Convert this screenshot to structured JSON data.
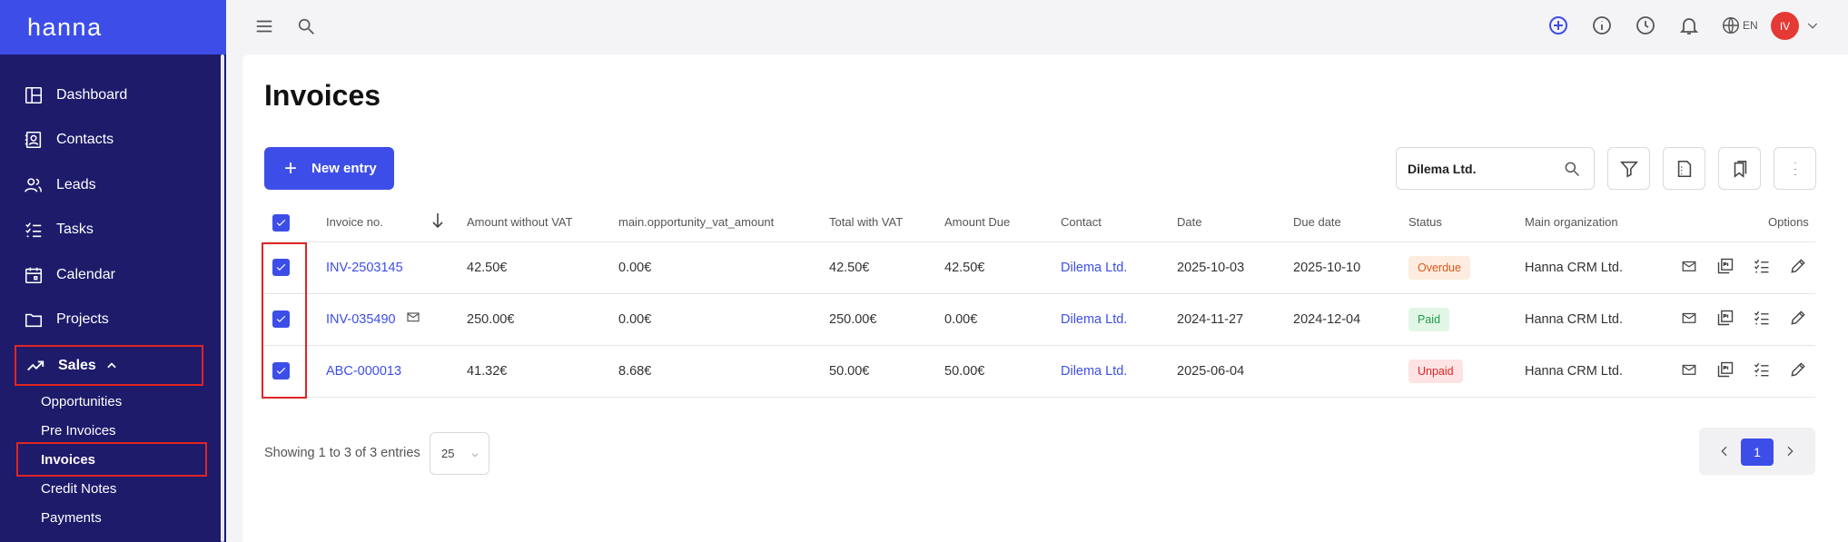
{
  "brand": "hanna",
  "sidebar": {
    "items": [
      {
        "label": "Dashboard",
        "icon": "dashboard-icon"
      },
      {
        "label": "Contacts",
        "icon": "contacts-icon"
      },
      {
        "label": "Leads",
        "icon": "leads-icon"
      },
      {
        "label": "Tasks",
        "icon": "tasks-icon"
      },
      {
        "label": "Calendar",
        "icon": "calendar-icon"
      },
      {
        "label": "Projects",
        "icon": "folder-icon"
      }
    ],
    "sales": {
      "label": "Sales",
      "icon": "trending-up-icon"
    },
    "sales_sub": [
      "Opportunities",
      "Pre Invoices",
      "Invoices",
      "Credit Notes",
      "Payments"
    ]
  },
  "topbar": {
    "lang": "EN",
    "avatar": "IV"
  },
  "page": {
    "title": "Invoices",
    "new_entry": "New entry",
    "search_value": "Dilema Ltd."
  },
  "table": {
    "headers": [
      "Invoice no.",
      "Amount without VAT",
      "main.opportunity_vat_amount",
      "Total with VAT",
      "Amount Due",
      "Contact",
      "Date",
      "Due date",
      "Status",
      "Main organization",
      "Options"
    ],
    "rows": [
      {
        "invoice": "INV-2503145",
        "amount": "42.50€",
        "vat": "0.00€",
        "total": "42.50€",
        "due_amount": "42.50€",
        "contact": "Dilema Ltd.",
        "date": "2025-10-03",
        "due_date": "2025-10-10",
        "status": "Overdue",
        "org": "Hanna CRM Ltd."
      },
      {
        "invoice": "INV-035490",
        "amount": "250.00€",
        "vat": "0.00€",
        "total": "250.00€",
        "due_amount": "0.00€",
        "contact": "Dilema Ltd.",
        "date": "2024-11-27",
        "due_date": "2024-12-04",
        "status": "Paid",
        "org": "Hanna CRM Ltd."
      },
      {
        "invoice": "ABC-000013",
        "amount": "41.32€",
        "vat": "8.68€",
        "total": "50.00€",
        "due_amount": "50.00€",
        "contact": "Dilema Ltd.",
        "date": "2025-06-04",
        "due_date": "",
        "status": "Unpaid",
        "org": "Hanna CRM Ltd."
      }
    ]
  },
  "footer": {
    "showing": "Showing 1 to 3 of 3 entries",
    "per_page": "25",
    "page": "1"
  },
  "colors": {
    "accent": "#3d4ee8",
    "sidebar": "#1e1b6b",
    "highlight": "#e02424"
  }
}
